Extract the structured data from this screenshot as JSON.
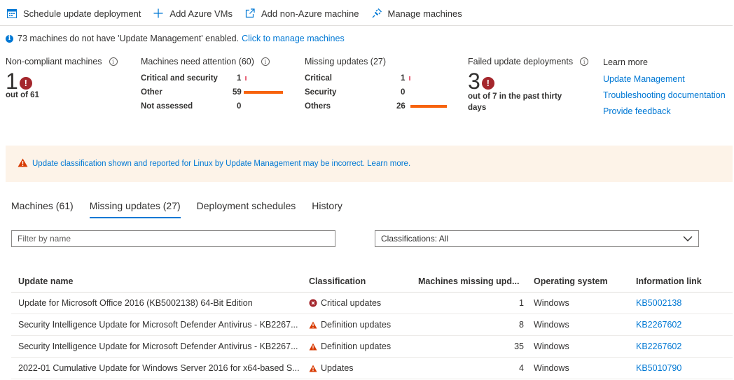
{
  "toolbar": {
    "schedule": "Schedule update deployment",
    "add_azure": "Add Azure VMs",
    "add_non_azure": "Add non-Azure machine",
    "manage": "Manage machines"
  },
  "info": {
    "text": "73 machines do not have 'Update Management' enabled.",
    "link": "Click to manage machines"
  },
  "tiles": {
    "noncompliant": {
      "title": "Non-compliant machines",
      "value": "1",
      "sub": "out of 61"
    },
    "attention": {
      "title": "Machines need attention (60)",
      "rows": [
        {
          "label": "Critical and security",
          "value": "1",
          "fraction": 0.02
        },
        {
          "label": "Other",
          "value": "59",
          "fraction": 1.0
        },
        {
          "label": "Not assessed",
          "value": "0",
          "fraction": 0
        }
      ]
    },
    "missing": {
      "title": "Missing updates (27)",
      "rows": [
        {
          "label": "Critical",
          "value": "1",
          "fraction": 0.04
        },
        {
          "label": "Security",
          "value": "0",
          "fraction": 0
        },
        {
          "label": "Others",
          "value": "26",
          "fraction": 1.0
        }
      ]
    },
    "failed": {
      "title": "Failed update deployments",
      "value": "3",
      "sub_line1": "out of 7 in the past thirty",
      "sub_line2": "days"
    }
  },
  "learn": {
    "title": "Learn more",
    "links": [
      "Update Management",
      "Troubleshooting documentation",
      "Provide feedback"
    ]
  },
  "banner": {
    "text": "Update classification shown and reported for Linux by Update Management may be incorrect. Learn more."
  },
  "tabs": [
    "Machines (61)",
    "Missing updates (27)",
    "Deployment schedules",
    "History"
  ],
  "filter": {
    "placeholder": "Filter by name"
  },
  "classification_select": {
    "value": "Classifications: All"
  },
  "table": {
    "headers": [
      "Update name",
      "Classification",
      "Machines missing upd...",
      "Operating system",
      "Information link"
    ],
    "rows": [
      {
        "name": "Update for Microsoft Office 2016 (KB5002138) 64-Bit Edition",
        "classification": "Critical updates",
        "icon": "critical-icon",
        "machines": "1",
        "os": "Windows",
        "link": "KB5002138"
      },
      {
        "name": "Security Intelligence Update for Microsoft Defender Antivirus - KB2267...",
        "classification": "Definition updates",
        "icon": "warning-icon",
        "machines": "8",
        "os": "Windows",
        "link": "KB2267602"
      },
      {
        "name": "Security Intelligence Update for Microsoft Defender Antivirus - KB2267...",
        "classification": "Definition updates",
        "icon": "warning-icon",
        "machines": "35",
        "os": "Windows",
        "link": "KB2267602"
      },
      {
        "name": "2022-01 Cumulative Update for Windows Server 2016 for x64-based S...",
        "classification": "Updates",
        "icon": "warning-icon",
        "machines": "4",
        "os": "Windows",
        "link": "KB5010790"
      }
    ]
  },
  "colors": {
    "accent": "#0078d4",
    "bar": "#f7630c",
    "error": "#a4262c",
    "warning": "#d83b01"
  }
}
